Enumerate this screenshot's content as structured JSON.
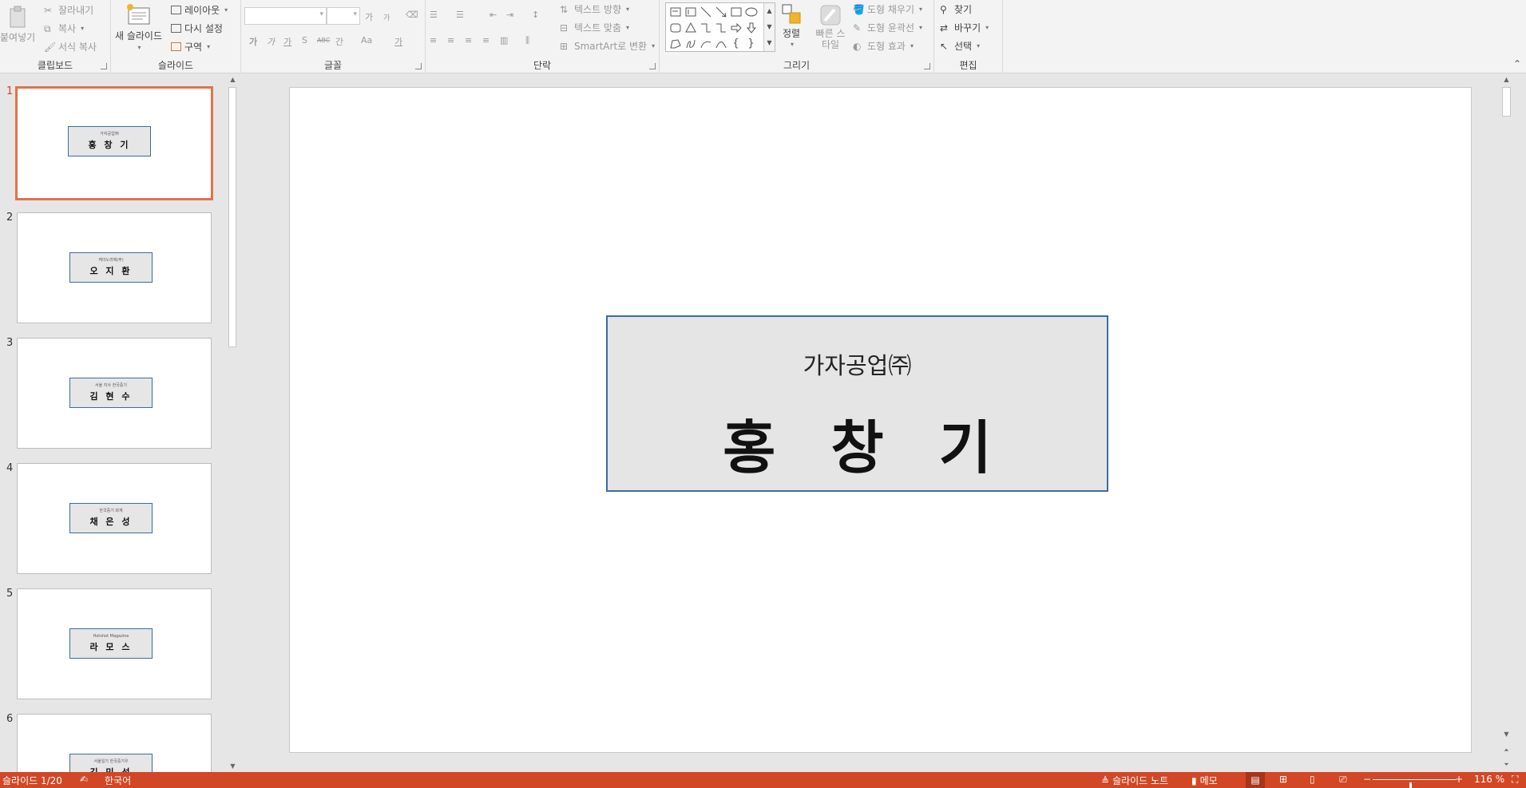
{
  "ribbon": {
    "clipboard": {
      "label": "클립보드",
      "paste": "붙여넣기",
      "cut": "잘라내기",
      "copy": "복사",
      "format_painter": "서식 복사"
    },
    "slides": {
      "label": "슬라이드",
      "new_slide": "새 슬라이드",
      "layout": "레이아웃",
      "reset": "다시 설정",
      "section": "구역"
    },
    "font": {
      "label": "글꼴",
      "grow": "가",
      "shrink": "가",
      "bold": "가",
      "italic": "가",
      "underline": "가",
      "strike": "S",
      "abc": "ABC",
      "spacing": "간",
      "case": "Aa",
      "color": "가"
    },
    "paragraph": {
      "label": "단락",
      "text_direction": "텍스트 방향",
      "align_text": "텍스트 맞춤",
      "smartart": "SmartArt로 변환"
    },
    "drawing": {
      "label": "그리기",
      "arrange": "정렬",
      "quick_styles": "빠른 스타일",
      "fill": "도형 채우기",
      "outline": "도형 윤곽선",
      "effects": "도형 효과"
    },
    "editing": {
      "label": "편집",
      "find": "찾기",
      "replace": "바꾸기",
      "select": "선택"
    }
  },
  "thumbnails": [
    {
      "num": "1",
      "subtitle": "가자공업㈜",
      "name": "홍 창 기",
      "selected": true
    },
    {
      "num": "2",
      "subtitle": "케이노리텍(주)",
      "name": "오 지 환",
      "selected": false
    },
    {
      "num": "3",
      "subtitle": "서울 지사 한국중기",
      "name": "김 현 수",
      "selected": false
    },
    {
      "num": "4",
      "subtitle": "한국중기 회계",
      "name": "채 은 성",
      "selected": false
    },
    {
      "num": "5",
      "subtitle": "Hotshot Magazine",
      "name": "라 모 스",
      "selected": false
    },
    {
      "num": "6",
      "subtitle": "서울일기 한국중기우",
      "name": "김 민 성",
      "selected": false
    }
  ],
  "slide": {
    "company": "가자공업㈜",
    "person": "홍 창 기"
  },
  "status": {
    "slide_counter": "슬라이드 1/20",
    "language": "한국어",
    "notes": "슬라이드 노트",
    "comments": "메모",
    "zoom_minus": "−",
    "zoom_plus": "+",
    "zoom_level": "116 %",
    "zoom_fraction": 0.45,
    "accent": "#d24726"
  }
}
